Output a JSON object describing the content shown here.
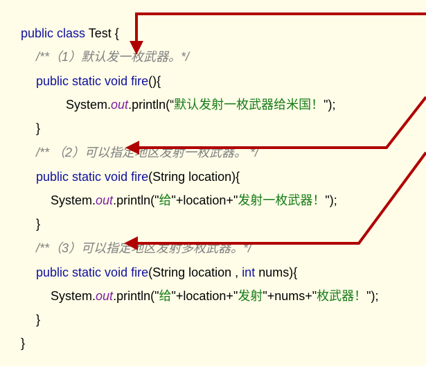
{
  "code": {
    "line1": {
      "kw": "public class",
      "rest": " Test {"
    },
    "line2": {
      "comment": "/**（1）默认发一枚武器。*/"
    },
    "line3": {
      "kw": "public static void",
      "sp": " ",
      "name": "fire",
      "rest": "(){"
    },
    "line4": {
      "pre": "System.",
      "field": "out",
      "mid": ".println(“",
      "str": "默认发射一枚武器给米国！",
      "post": "\");"
    },
    "line5": {
      "text": "}"
    },
    "line6": {
      "comment": "/** （2）可以指定地区发射一枚武器。 */"
    },
    "line7": {
      "kw": "public static void",
      "sp": " ",
      "name": "fire",
      "rest": "(String location){"
    },
    "line8": {
      "pre": "System.",
      "field": "out",
      "mid": ".println(\"",
      "str1": "给",
      "mid2": "\"+location+\"",
      "str2": "发射一枚武器！",
      "post": "\");"
    },
    "line9": {
      "text": "}"
    },
    "line10": {
      "comment": "/**（3）可以指定地区发射多枚武器。*/"
    },
    "line11": {
      "kw": "public static void",
      "sp": " ",
      "name": "fire",
      "rest1": "(String location , ",
      "kw2": "int",
      "rest2": " nums){"
    },
    "line12": {
      "pre": "System.",
      "field": "out",
      "mid": ".println(\"",
      "str1": "给",
      "mid2": "\"+location+\"",
      "str2": "发射",
      "mid3": "\"+nums+\"",
      "str3": "枚武器！",
      "post": "\");"
    },
    "line13": {
      "text": "}"
    },
    "line14": {
      "text": "}"
    }
  },
  "colors": {
    "background": "#fffde8",
    "keyword": "#0f0f9e",
    "comment": "#7f7f7f",
    "string": "#157a15",
    "field": "#7b1fa2",
    "arrow": "#b00000"
  }
}
